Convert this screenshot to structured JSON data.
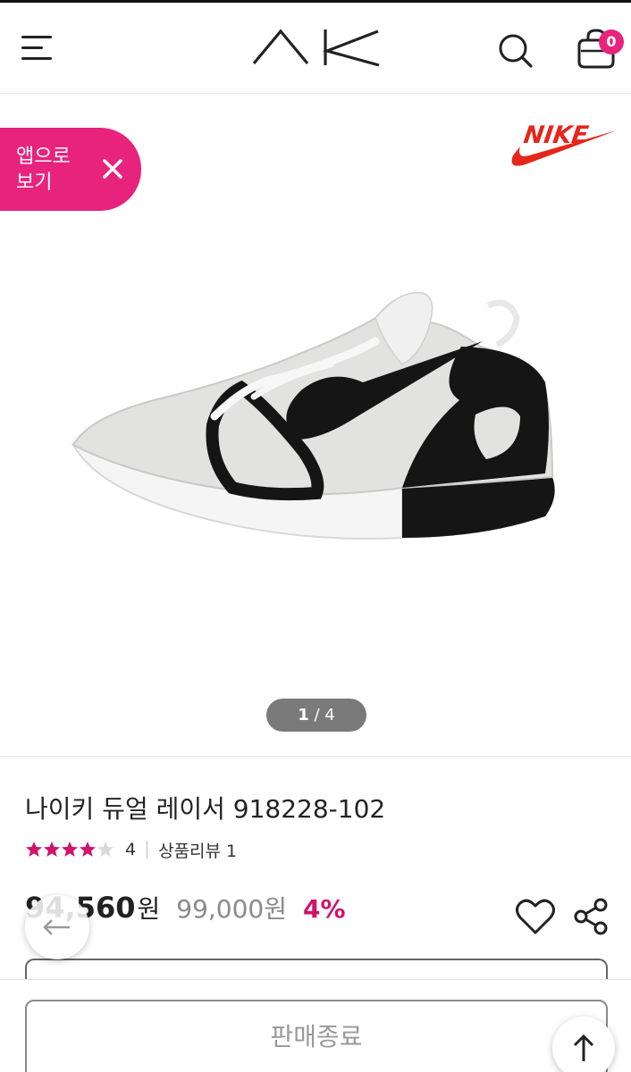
{
  "header": {
    "logo_text": "AK",
    "icons": [
      "menu-icon",
      "search-icon",
      "cart-icon"
    ],
    "cart_count": "0"
  },
  "product_image": {
    "brand": "NIKE",
    "app_banner": {
      "label": "앱으로 보기",
      "icon": "close-icon"
    },
    "pager": {
      "current": "1",
      "separator": " / ",
      "total": "4"
    }
  },
  "product": {
    "title": "나이키 듀얼 레이서 918228-102",
    "rating": 4,
    "rating_text": "4",
    "review_label": "상품리뷰 1",
    "price_now": "94,560",
    "currency": "원",
    "price_original": "99,000원",
    "discount": "4%"
  },
  "footer": {
    "soldout_label": "판매종료"
  },
  "colors": {
    "accent": "#e8237d",
    "discount": "#d0136b",
    "star_on": "#d0136b",
    "star_off": "#d9d9d9",
    "nike_red": "#e4261b"
  }
}
